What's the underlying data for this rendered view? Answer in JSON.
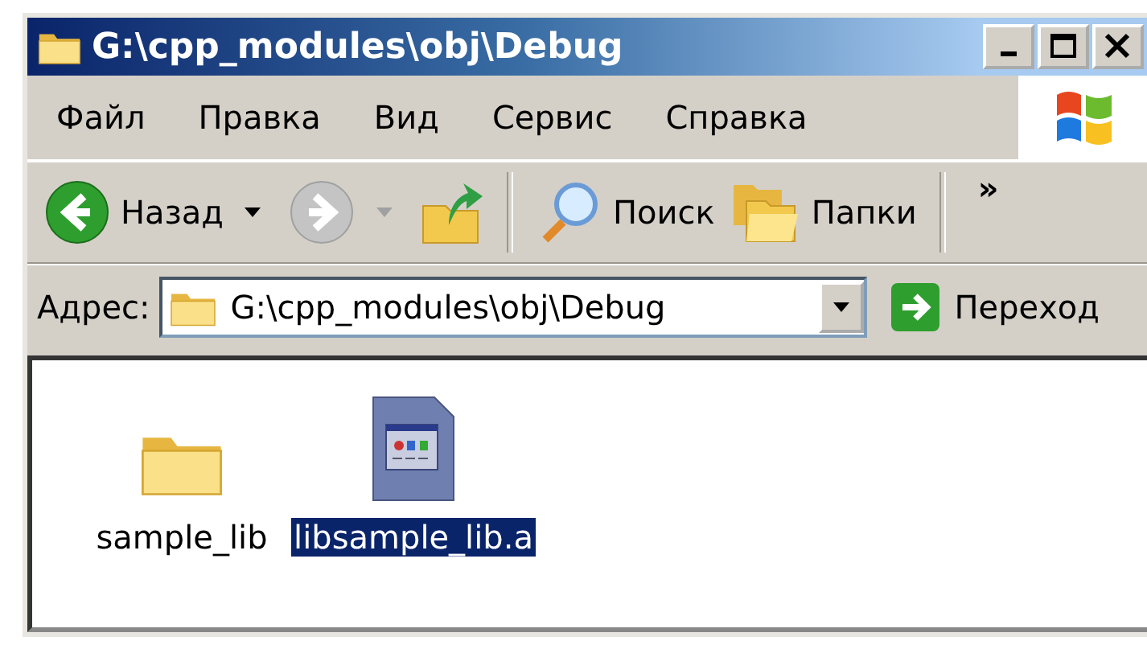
{
  "window": {
    "title": "G:\\cpp_modules\\obj\\Debug"
  },
  "menu": [
    "Файл",
    "Правка",
    "Вид",
    "Сервис",
    "Справка"
  ],
  "toolbar": [
    {
      "kind": "back",
      "label": "Назад",
      "disabled": false
    },
    {
      "kind": "forward",
      "disabled": true
    },
    {
      "kind": "up"
    },
    {
      "kind": "separator"
    },
    {
      "kind": "search",
      "label": "Поиск"
    },
    {
      "kind": "folders",
      "label": "Папки"
    },
    {
      "kind": "separator"
    },
    {
      "kind": "more",
      "label": "»"
    }
  ],
  "address": {
    "label": "Адрес:",
    "value": "G:\\cpp_modules\\obj\\Debug",
    "go": "Переход"
  },
  "files": [
    {
      "kind": "folder",
      "name": "sample_lib",
      "selected": false
    },
    {
      "kind": "library",
      "name": "libsample_lib.a",
      "selected": true
    }
  ]
}
